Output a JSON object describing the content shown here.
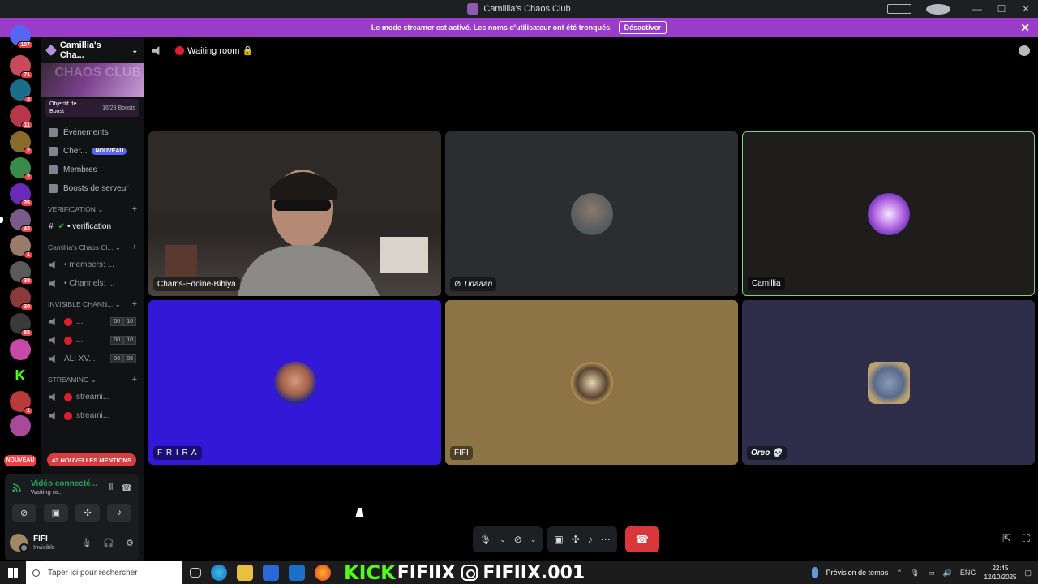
{
  "window": {
    "title": "Camillia's Chaos Club"
  },
  "banner": {
    "text": "Le mode streamer est activé. Les noms d'utilisateur ont été tronqués.",
    "button": "Désactiver",
    "close": "✕"
  },
  "servers": {
    "badges": [
      "107",
      "71",
      "3",
      "11",
      "2",
      "2",
      "35",
      "43",
      "1",
      "38",
      "30",
      "65",
      "1"
    ],
    "nouveau": "NOUVEAU"
  },
  "guild": {
    "name": "Camillia's Cha...",
    "banner_text": "CHAOS CLUB",
    "boost": {
      "label": "Objectif de Boost",
      "count": "16/28 Boosts"
    },
    "nav": [
      {
        "label": "Événements"
      },
      {
        "label": "Cher...",
        "badge": "NOUVEAU"
      },
      {
        "label": "Membres"
      },
      {
        "label": "Boosts de serveur"
      }
    ],
    "categories": {
      "verification": "VERIFICATION",
      "chaos": "Camillia's Chaos Cl...",
      "invisible": "INVISIBLE CHANN...",
      "streaming": "STREAMING"
    },
    "channels": {
      "verification": "• verification",
      "members": "• members: ...",
      "chans": "• Channels: ...",
      "inv1": "...",
      "inv2": "...",
      "ali": "ALI XV...",
      "stream1": "streami...",
      "stream2": "streami..."
    },
    "counts": {
      "a": "00",
      "b": "10",
      "c": "00",
      "d": "10",
      "e": "00",
      "f": "08"
    },
    "mentions": "43 NOUVELLES MENTIONS"
  },
  "voice": {
    "status": "Vidéo connecté...",
    "channel": "Waiting ro...",
    "user": {
      "name": "FIFI",
      "status": "Invisible"
    }
  },
  "stage": {
    "channel": "Waiting room 🔒",
    "tiles": [
      {
        "name": "Chams-Eddine-Bibiya"
      },
      {
        "name": "Tidaaan"
      },
      {
        "name": "Camillia"
      },
      {
        "name": "F R I R A"
      },
      {
        "name": "FIFI"
      },
      {
        "name": "Oreo 💀"
      }
    ]
  },
  "taskbar": {
    "search_placeholder": "Taper ici pour rechercher",
    "kick": "KICK",
    "kick_name": "FIFIIX",
    "ig_name": "FIFIIX.001",
    "weather": "Prévision de temps",
    "lang": "ENG",
    "time": "22:45",
    "date": "12/10/2025"
  },
  "colors": {
    "accent": "#5865f2",
    "banner": "#9a3cc9",
    "danger": "#da373c",
    "online": "#23a55a"
  }
}
